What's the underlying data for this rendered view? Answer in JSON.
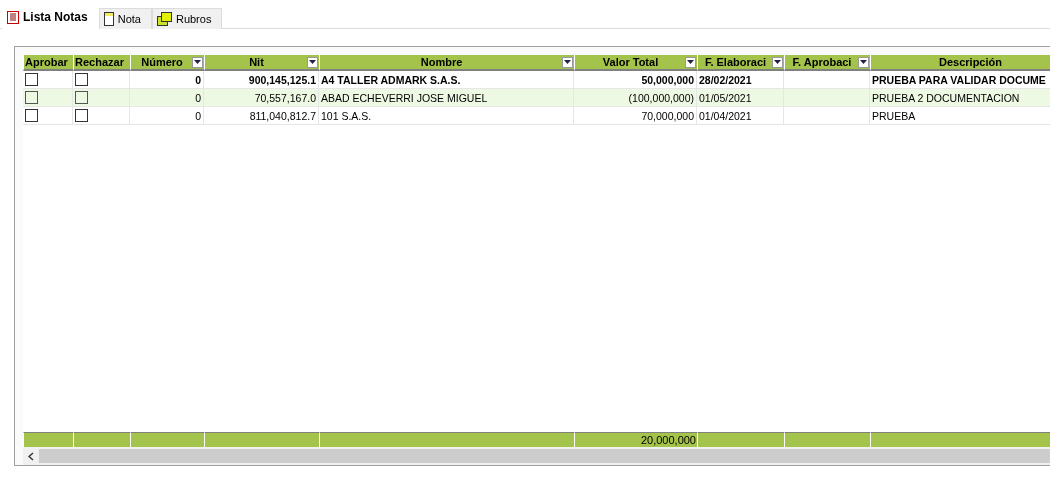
{
  "tabs": [
    {
      "label": "Lista Notas",
      "kind": "list",
      "selected": true
    },
    {
      "label": "Nota",
      "kind": "note",
      "selected": false
    },
    {
      "label": "Rubros",
      "kind": "folders",
      "selected": false
    }
  ],
  "table": {
    "columns": [
      {
        "label": "Aprobar",
        "filter": false,
        "kind": "check"
      },
      {
        "label": "Rechazar",
        "filter": false,
        "kind": "check"
      },
      {
        "label": "Número",
        "filter": true,
        "kind": "number"
      },
      {
        "label": "Nit",
        "filter": true,
        "kind": "number"
      },
      {
        "label": "Nombre",
        "filter": true,
        "kind": "text"
      },
      {
        "label": "Valor Total",
        "filter": true,
        "kind": "number",
        "total": "20,000,000"
      },
      {
        "label": "F. Elaboraci",
        "filter": true,
        "kind": "text"
      },
      {
        "label": "F. Aprobaci",
        "filter": true,
        "kind": "text"
      },
      {
        "label": "Descripción",
        "filter": false,
        "kind": "text"
      }
    ],
    "rows": [
      {
        "selected": true,
        "cells": [
          {
            "checked": false
          },
          {
            "checked": false
          },
          "0",
          "900,145,125.1",
          "A4 TALLER ADMARK S.A.S.",
          "50,000,000",
          "28/02/2021",
          null,
          "PRUEBA PARA VALIDAR DOCUME"
        ]
      },
      {
        "selected": false,
        "cells": [
          {
            "checked": false
          },
          {
            "checked": false
          },
          "0",
          "70,557,167.0",
          "ABAD ECHEVERRI JOSE MIGUEL",
          "(100,000,000)",
          "01/05/2021",
          null,
          "PRUEBA 2 DOCUMENTACION"
        ]
      },
      {
        "selected": false,
        "cells": [
          {
            "checked": false
          },
          {
            "checked": false
          },
          "0",
          "811,040,812.7",
          "101   S.A.S.",
          "70,000,000",
          "01/04/2021",
          null,
          "PRUEBA"
        ]
      }
    ]
  }
}
